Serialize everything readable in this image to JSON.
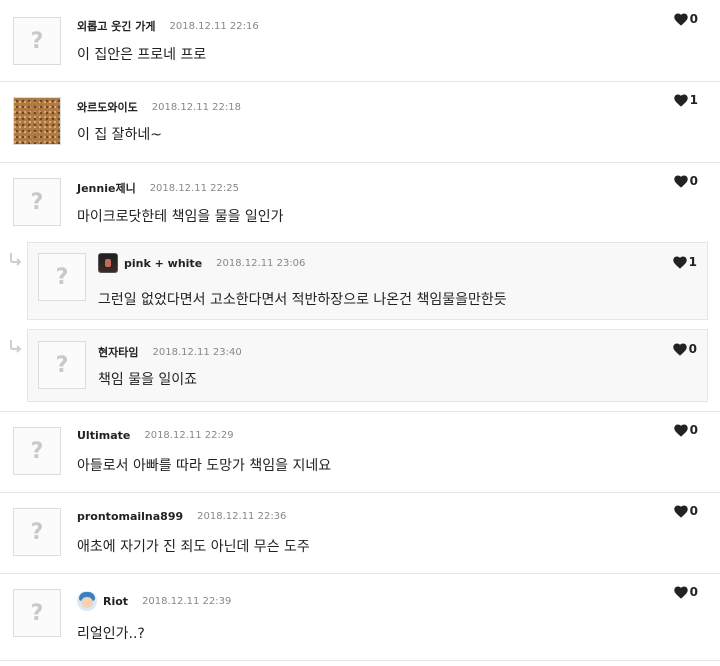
{
  "comments": [
    {
      "nick": "외롭고 웃긴 가게",
      "date": "2018.12.11 22:16",
      "text": "이 집안은 프로네 프로",
      "likes": "0"
    },
    {
      "nick": "와르도와이도",
      "date": "2018.12.11 22:18",
      "text": "이 집 잘하네~",
      "likes": "1"
    },
    {
      "nick": "Jennie제니",
      "date": "2018.12.11 22:25",
      "text": "마이크로닷한테 책임을 물을 일인가",
      "likes": "0"
    },
    {
      "nick": "pink + white",
      "date": "2018.12.11 23:06",
      "text": "그런일 없었다면서 고소한다면서 적반하장으로 나온건 책임물을만한듯",
      "likes": "1"
    },
    {
      "nick": "현자타임",
      "date": "2018.12.11 23:40",
      "text": "책임 물을 일이죠",
      "likes": "0"
    },
    {
      "nick": "Ultimate",
      "date": "2018.12.11 22:29",
      "text": "아들로서 아빠를 따라 도망가 책임을 지네요",
      "likes": "0"
    },
    {
      "nick": "prontomailna899",
      "date": "2018.12.11 22:36",
      "text": "애초에 자기가 진 죄도 아닌데 무슨 도주",
      "likes": "0"
    },
    {
      "nick": "Riot",
      "date": "2018.12.11 22:39",
      "text": "리얼인가..?",
      "likes": "0"
    }
  ],
  "icons": {
    "heart": "heart-icon",
    "placeholder": "question-mark",
    "reply": "reply-arrow-icon"
  },
  "colors": {
    "heart": "#222222",
    "border": "#e6e6e6",
    "reply_bg": "#f8f8f8"
  }
}
